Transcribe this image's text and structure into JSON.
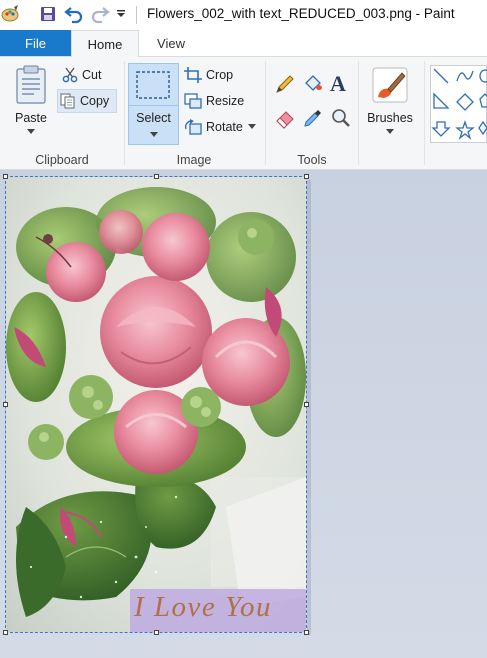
{
  "window": {
    "title": "Flowers_002_with text_REDUCED_003.png - Paint"
  },
  "tabs": {
    "file": "File",
    "home": "Home",
    "view": "View"
  },
  "clipboard": {
    "paste": "Paste",
    "cut": "Cut",
    "copy": "Copy",
    "group": "Clipboard"
  },
  "image": {
    "select": "Select",
    "crop": "Crop",
    "resize": "Resize",
    "rotate": "Rotate",
    "group": "Image"
  },
  "tools": {
    "group": "Tools"
  },
  "brushes": {
    "label": "Brushes"
  },
  "canvas": {
    "overlay_text": "I Love You"
  },
  "colors": {
    "accent": "#1979ca",
    "selected": "#c9e0f7",
    "text_overlay": "#b0704a",
    "text_overlay_bg": "#beaae1"
  }
}
